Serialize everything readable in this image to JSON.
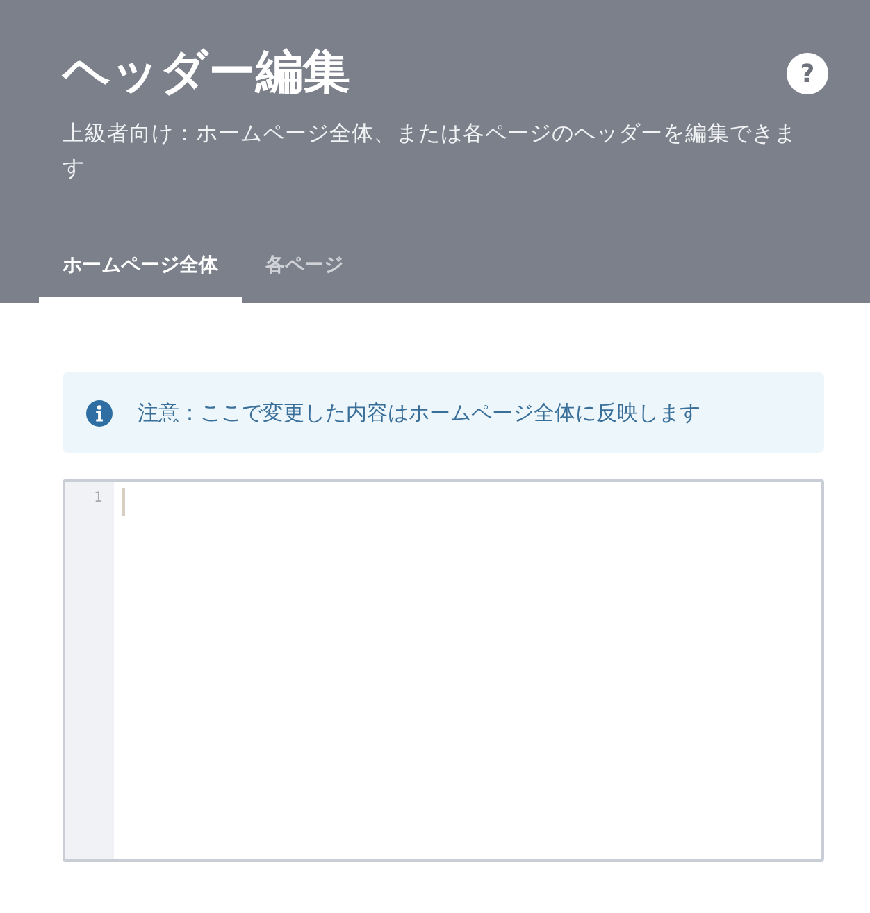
{
  "header": {
    "title": "ヘッダー編集",
    "help": "?",
    "subtitle": "上級者向け：ホームページ全体、または各ページのヘッダーを編集できます"
  },
  "tabs": [
    {
      "label": "ホームページ全体",
      "selected": true
    },
    {
      "label": "各ページ",
      "selected": false
    }
  ],
  "notice": {
    "text": "注意：ここで変更した内容はホームページ全体に反映します"
  },
  "editor": {
    "line_numbers": [
      "1"
    ]
  }
}
